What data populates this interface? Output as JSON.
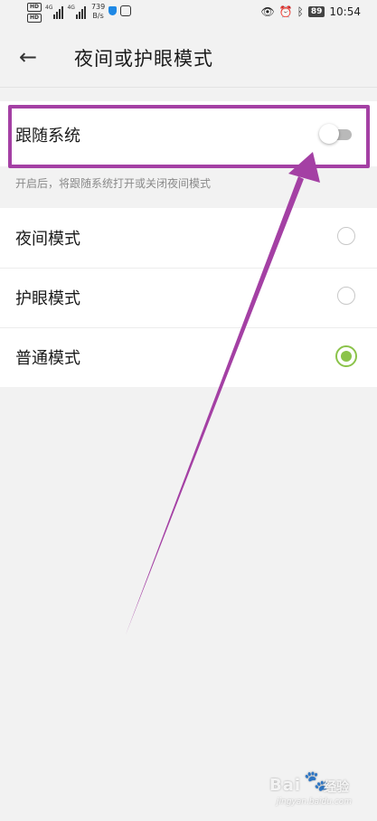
{
  "status_bar": {
    "hd1": "HD",
    "hd2": "HD",
    "sig1_label": "4G",
    "sig2_label": "4G",
    "net_speed_value": "739",
    "net_speed_unit": "B/s",
    "battery": "89",
    "time": "10:54"
  },
  "header": {
    "back_icon": "←",
    "title": "夜间或护眼模式"
  },
  "follow_system": {
    "label": "跟随系统",
    "enabled": false,
    "hint": "开启后，将跟随系统打开或关闭夜间模式"
  },
  "modes": [
    {
      "label": "夜间模式",
      "checked": false
    },
    {
      "label": "护眼模式",
      "checked": false
    },
    {
      "label": "普通模式",
      "checked": true
    }
  ],
  "colors": {
    "accent_green": "#8bc34a",
    "annotation_purple": "#a440a4",
    "background": "#f2f2f2"
  },
  "watermark": {
    "brand": "Bai",
    "paw": "🐾",
    "sub": "经验",
    "url": "jingyan.baidu.com"
  }
}
